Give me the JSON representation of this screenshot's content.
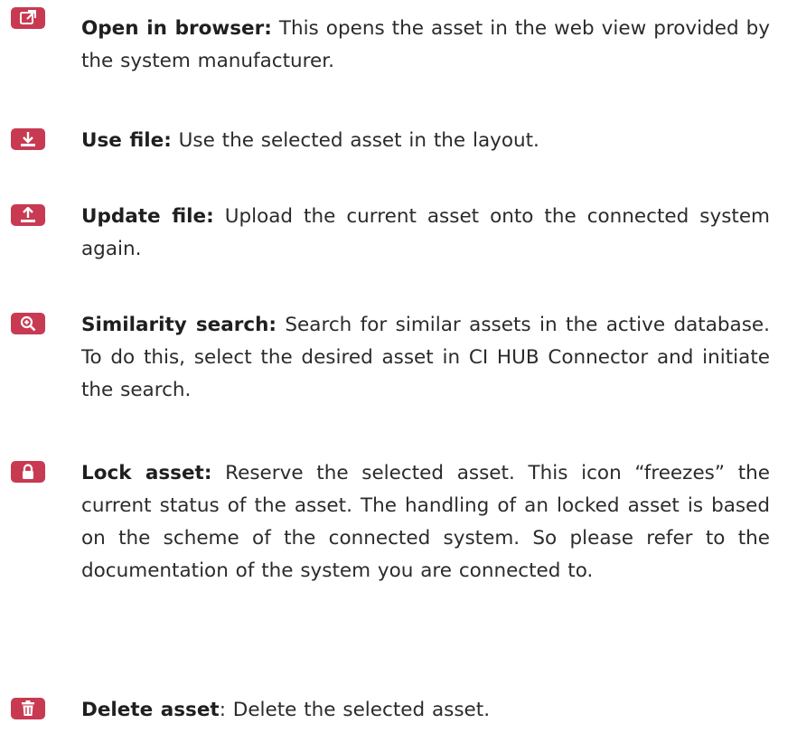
{
  "colors": {
    "icon_background": "#c83a52",
    "icon_foreground": "#ffffff",
    "text": "#2b2b2b"
  },
  "items": [
    {
      "icon": "open-external-icon",
      "term": "Open in browser:",
      "separator": "",
      "description": " This opens the asset in the web view provided by the system manufacturer."
    },
    {
      "icon": "download-icon",
      "term": "Use file:",
      "separator": "",
      "description": " Use the selected asset in the layout."
    },
    {
      "icon": "upload-icon",
      "term": "Update file:",
      "separator": "",
      "description": " Upload the current asset onto the connected system again."
    },
    {
      "icon": "zoom-in-icon",
      "term": "Similarity search:",
      "separator": "",
      "description": " Search for similar assets in the active database. To do this, select the desired asset in CI HUB Connector and initiate the search."
    },
    {
      "icon": "lock-icon",
      "term": "Lock asset:",
      "separator": "",
      "description": " Reserve the selected asset. This icon “freezes” the current status of the asset. The handling of an locked asset is based on the scheme of the connected system. So please refer to the documentation of the system you are connected to."
    },
    {
      "icon": "trash-icon",
      "term": "Delete asset",
      "separator": ":",
      "description": " Delete the selected asset."
    }
  ]
}
